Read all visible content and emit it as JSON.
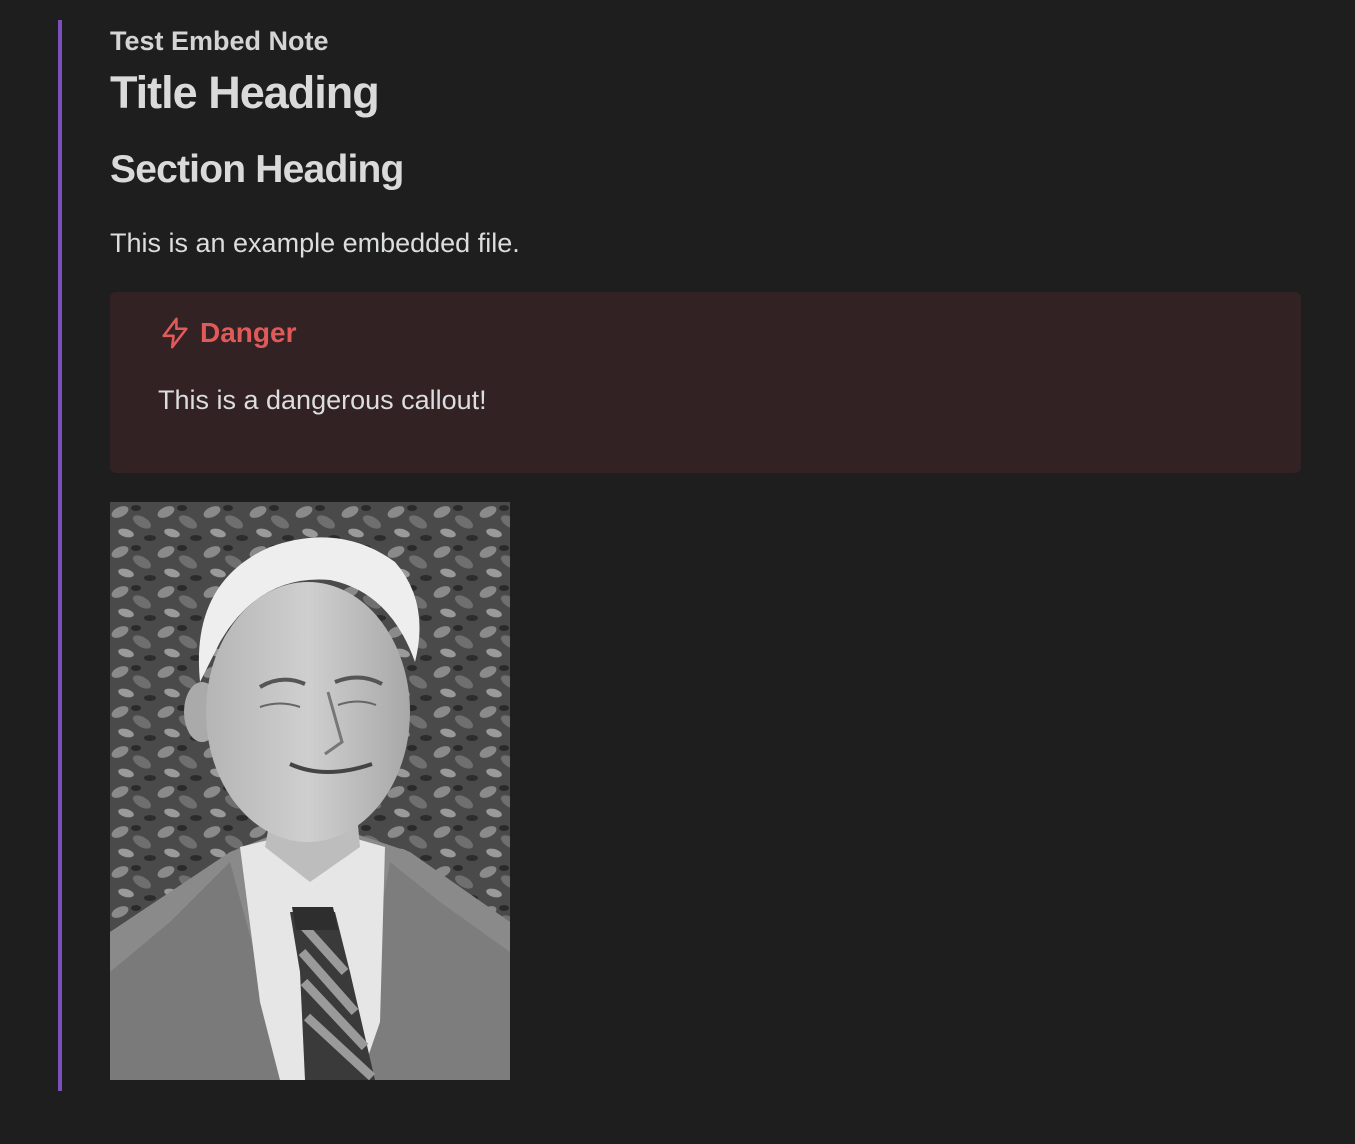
{
  "note": {
    "embed_title": "Test Embed Note",
    "title_heading": "Title Heading",
    "section_heading": "Section Heading",
    "paragraph": "This is an example embedded file."
  },
  "callout": {
    "type": "danger",
    "icon": "lightning-bolt-icon",
    "title": "Danger",
    "body": "This is a dangerous callout!",
    "accent_color": "#e05a5a",
    "background_color": "#332223"
  },
  "image": {
    "subject": "black-and-white portrait photo"
  },
  "colors": {
    "background": "#1e1e1e",
    "embed_border": "#7b4fbd",
    "text": "#dcddde"
  }
}
